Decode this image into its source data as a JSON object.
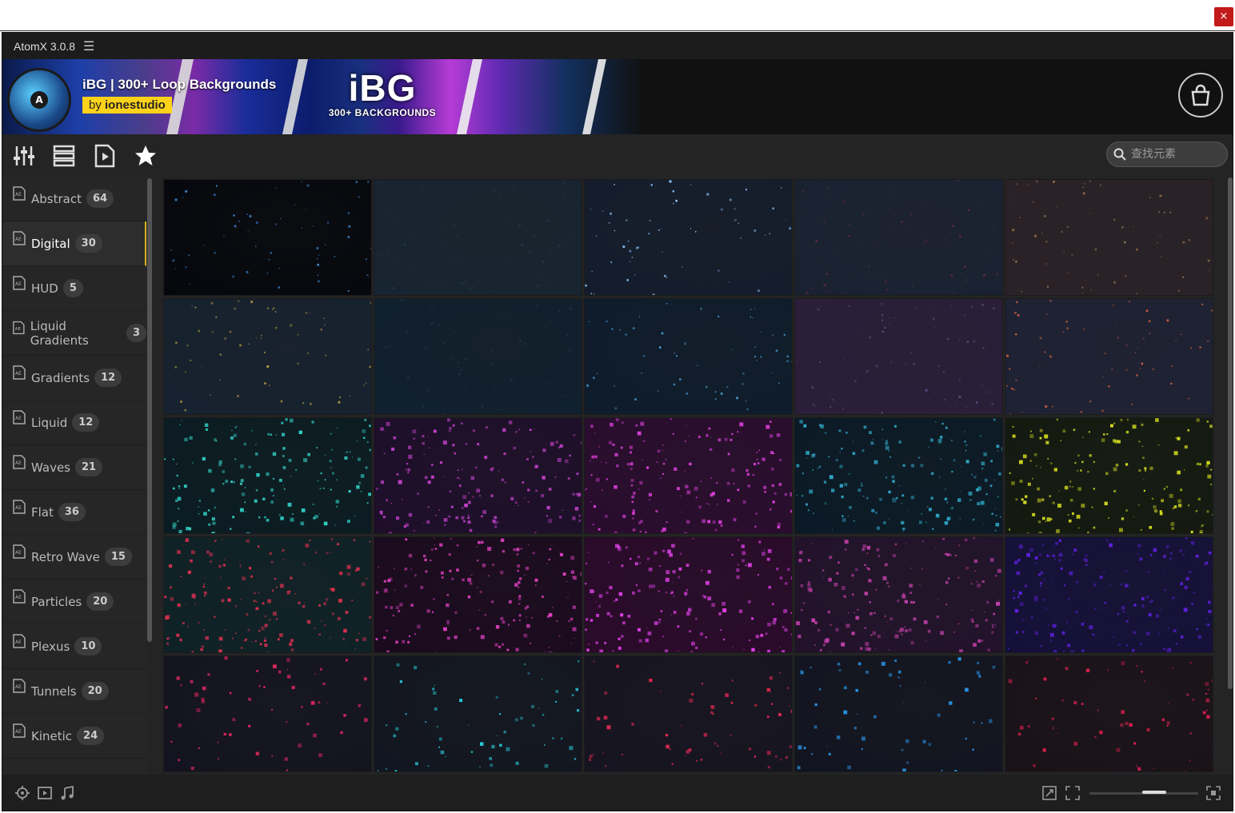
{
  "window": {
    "close_label": "×"
  },
  "app": {
    "title": "AtomX 3.0.8",
    "menu_icon": "hamburger-icon"
  },
  "banner": {
    "title": "iBG | 300+ Loop Backgrounds",
    "author_prefix": "by ",
    "author": "ionestudio",
    "logo_letter": "A",
    "promo_big": "iBG",
    "promo_small": "300+ BACKGROUNDS",
    "cart_icon": "shopping-bag-icon"
  },
  "toolbar": {
    "icons": [
      "sliders-icon",
      "list-icon",
      "document-play-icon",
      "star-icon"
    ],
    "search_placeholder": "查找元素"
  },
  "sidebar": {
    "items": [
      {
        "label": "Abstract",
        "count": "64"
      },
      {
        "label": "Digital",
        "count": "30",
        "active": true
      },
      {
        "label": "HUD",
        "count": "5"
      },
      {
        "label": "Liquid Gradients",
        "count": "3"
      },
      {
        "label": "Gradients",
        "count": "12"
      },
      {
        "label": "Liquid",
        "count": "12"
      },
      {
        "label": "Waves",
        "count": "21"
      },
      {
        "label": "Flat",
        "count": "36"
      },
      {
        "label": "Retro Wave",
        "count": "15"
      },
      {
        "label": "Particles",
        "count": "20"
      },
      {
        "label": "Plexus",
        "count": "10"
      },
      {
        "label": "Tunnels",
        "count": "20"
      },
      {
        "label": "Kinetic",
        "count": "24"
      }
    ]
  },
  "grid": {
    "thumbnails": [
      {
        "bg": "#05070c",
        "dot": "#3a8ad8"
      },
      {
        "bg": "#172431",
        "dot": "#22384a"
      },
      {
        "bg": "#141c2c",
        "dot": "#8cc8ff"
      },
      {
        "bg": "#1a2232",
        "dot": "#5a2a3a"
      },
      {
        "bg": "#2a2226",
        "dot": "#8a6a4a"
      },
      {
        "bg": "#162230",
        "dot": "#b8a040"
      },
      {
        "bg": "#10202e",
        "dot": "#1e3346"
      },
      {
        "bg": "#0e1c2c",
        "dot": "#4a9ed8"
      },
      {
        "bg": "#2a1e3a",
        "dot": "#5a4a7a"
      },
      {
        "bg": "#1e2234",
        "dot": "#d06040"
      },
      {
        "bg": "#0a1c22",
        "dot": "#34d2c8"
      },
      {
        "bg": "#1e0e2a",
        "dot": "#c040c8"
      },
      {
        "bg": "#2a0c2e",
        "dot": "#e040e0"
      },
      {
        "bg": "#0a1a26",
        "dot": "#30a8c8"
      },
      {
        "bg": "#141a10",
        "dot": "#d8e020"
      },
      {
        "bg": "#0e2226",
        "dot": "#e03050"
      },
      {
        "bg": "#1a0a1e",
        "dot": "#e040c0"
      },
      {
        "bg": "#2a0a2a",
        "dot": "#e040e8"
      },
      {
        "bg": "#22122a",
        "dot": "#c040a8"
      },
      {
        "bg": "#14103a",
        "dot": "#6020e0"
      },
      {
        "bg": "#141420",
        "dot": "#e02860"
      },
      {
        "bg": "#121620",
        "dot": "#28c8d8"
      },
      {
        "bg": "#161420",
        "dot": "#e02850"
      },
      {
        "bg": "#121420",
        "dot": "#2890e0"
      },
      {
        "bg": "#1a1218",
        "dot": "#e02050"
      }
    ]
  },
  "footer": {
    "left_icons": [
      "gear-target-icon",
      "video-icon",
      "music-note-icon"
    ],
    "right_icons": [
      "expand-icon",
      "fullscreen-icon",
      "grid-size-icon"
    ],
    "zoom": 0.6
  }
}
